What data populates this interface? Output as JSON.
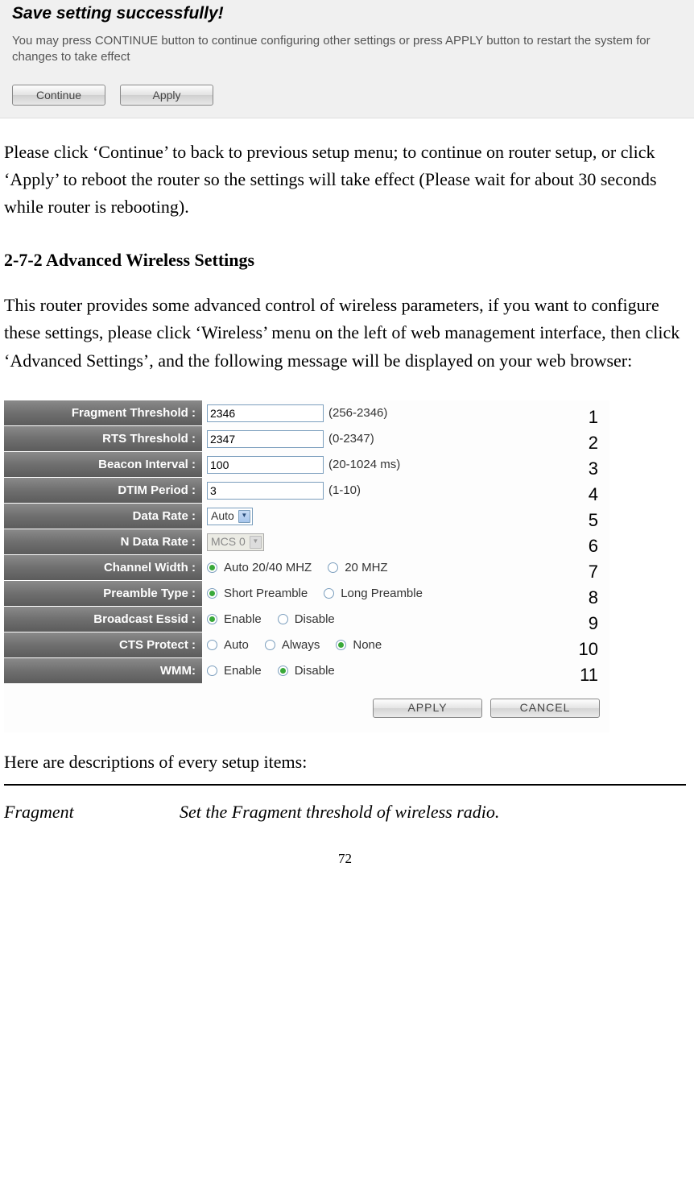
{
  "screenshot1": {
    "title": "Save setting successfully!",
    "text": "You may press CONTINUE button to continue configuring other settings or press APPLY button to restart the system for changes to take effect",
    "continue_label": "Continue",
    "apply_label": "Apply"
  },
  "para1": "Please click ‘Continue’ to back to previous setup menu; to continue on router setup, or click ‘Apply’ to reboot the router so the settings will take effect (Please wait for about 30 seconds while router is rebooting).",
  "section_title": "2-7-2 Advanced Wireless Settings",
  "para2": "This router provides some advanced control of wireless parameters, if you want to configure these settings, please click ‘Wireless’ menu on the left of web management interface, then click ‘Advanced Settings’, and the following message will be displayed on your web browser:",
  "settings": {
    "rows": [
      {
        "label": "Fragment Threshold :",
        "value": "2346",
        "hint": "(256-2346)",
        "callout": "1",
        "type": "text"
      },
      {
        "label": "RTS Threshold :",
        "value": "2347",
        "hint": "(0-2347)",
        "callout": "2",
        "type": "text"
      },
      {
        "label": "Beacon Interval :",
        "value": "100",
        "hint": "(20-1024 ms)",
        "callout": "3",
        "type": "text"
      },
      {
        "label": "DTIM Period :",
        "value": "3",
        "hint": "(1-10)",
        "callout": "4",
        "type": "text"
      },
      {
        "label": "Data Rate :",
        "value": "Auto",
        "callout": "5",
        "type": "select"
      },
      {
        "label": "N Data Rate :",
        "value": "MCS 0",
        "callout": "6",
        "type": "select-disabled"
      },
      {
        "label": "Channel Width :",
        "options": [
          "Auto 20/40 MHZ",
          "20 MHZ"
        ],
        "checked": 0,
        "callout": "7",
        "type": "radio"
      },
      {
        "label": "Preamble Type :",
        "options": [
          "Short Preamble",
          "Long Preamble"
        ],
        "checked": 0,
        "callout": "8",
        "type": "radio"
      },
      {
        "label": "Broadcast Essid :",
        "options": [
          "Enable",
          "Disable"
        ],
        "checked": 0,
        "callout": "9",
        "type": "radio"
      },
      {
        "label": "CTS Protect :",
        "options": [
          "Auto",
          "Always",
          "None"
        ],
        "checked": 2,
        "callout": "10",
        "type": "radio"
      },
      {
        "label": "WMM:",
        "options": [
          "Enable",
          "Disable"
        ],
        "checked": 1,
        "callout": "11",
        "type": "radio"
      }
    ],
    "apply_label": "APPLY",
    "cancel_label": "CANCEL"
  },
  "desc_intro": "Here are descriptions of every setup items:",
  "desc": {
    "term": "Fragment",
    "def": "Set the Fragment threshold of wireless radio."
  },
  "page_number": "72"
}
